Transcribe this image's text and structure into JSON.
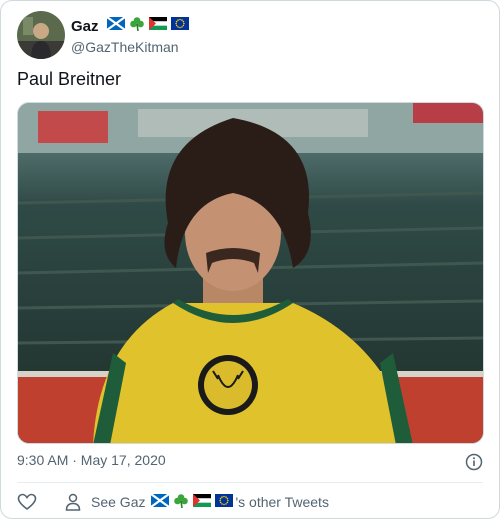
{
  "author": {
    "display_name": "Gaz",
    "handle": "@GazTheKitman",
    "flags": [
      "scotland-flag-icon",
      "shamrock-icon",
      "palestine-flag-icon",
      "eu-flag-icon"
    ]
  },
  "tweet": {
    "text": "Paul Breitner",
    "timestamp": "9:30 AM · May 17, 2020"
  },
  "footer": {
    "see_prefix": "See Gaz",
    "see_suffix": "'s other Tweets"
  },
  "colors": {
    "text": "#0f1419",
    "muted": "#536471",
    "border": "#cfd9de"
  }
}
